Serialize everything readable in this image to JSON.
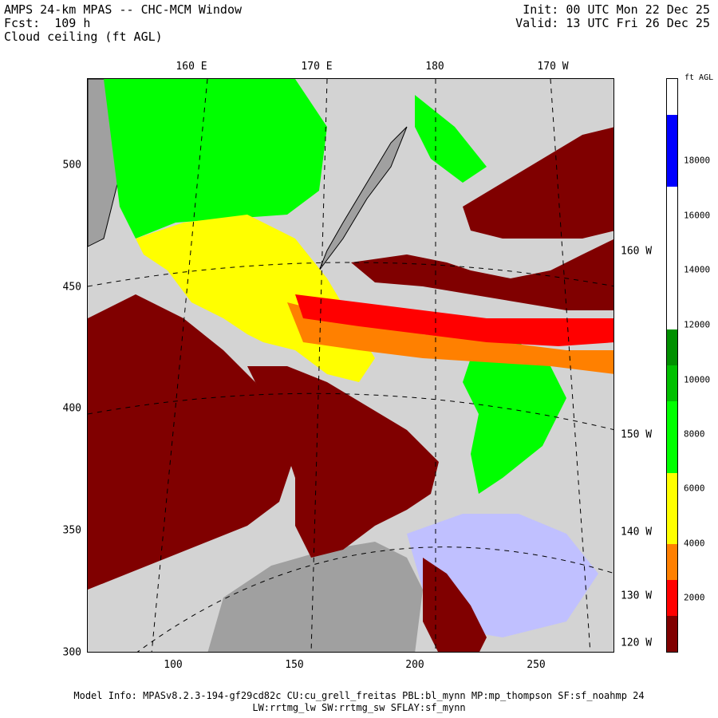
{
  "header": {
    "title": "AMPS 24-km MPAS -- CHC-MCM Window",
    "forecast": "Fcst:  109 h",
    "field": "Cloud ceiling (ft AGL)",
    "init": "Init: 00 UTC Mon 22 Dec 25",
    "valid": "Valid: 13 UTC Fri 26 Dec 25"
  },
  "map": {
    "top_longitude_labels": [
      "160 E",
      "170 E",
      "180",
      "170 W"
    ],
    "right_latitude_labels": [
      "160 W",
      "150 W",
      "140 W",
      "130 W",
      "120 W"
    ],
    "y_axis_ticks": [
      "500",
      "450",
      "400",
      "350",
      "300"
    ],
    "x_axis_ticks": [
      "100",
      "150",
      "200",
      "250"
    ]
  },
  "colorbar": {
    "unit_label": "ft AGL",
    "labels": [
      "18000",
      "16000",
      "14000",
      "12000",
      "10000",
      "8000",
      "6000",
      "4000",
      "2000"
    ],
    "segments": [
      {
        "color": "#800000"
      },
      {
        "color": "#ff0000"
      },
      {
        "color": "#ff8000"
      },
      {
        "color": "#ffff00"
      },
      {
        "color": "#ffff00"
      },
      {
        "color": "#00ff00"
      },
      {
        "color": "#00ff00"
      },
      {
        "color": "#00c000"
      },
      {
        "color": "#009000"
      },
      {
        "color": "#ffffff"
      },
      {
        "color": "#ffffff"
      },
      {
        "color": "#ffffff"
      },
      {
        "color": "#ffffff"
      },
      {
        "color": "#0000ff"
      },
      {
        "color": "#0000ff"
      },
      {
        "color": "#ffffff"
      }
    ]
  },
  "footer": {
    "line1": "Model Info: MPASv8.2.3-194-gf29cd82c CU:cu_grell_freitas PBL:bl_mynn MP:mp_thompson SF:sf_noahmp 24",
    "line2": "LW:rrtmg_lw SW:rrtmg_sw SFLAY:sf_mynn"
  },
  "colors": {
    "ocean": "#d3d3d3",
    "land": "#a0a0a0",
    "ice_shelf": "#c0c0ff",
    "lowest_ceiling": "#800000",
    "low_ceiling": "#ff0000",
    "mid_low_ceiling": "#ff8000",
    "mid_ceiling": "#ffff00",
    "high_ceiling": "#00ff00"
  }
}
